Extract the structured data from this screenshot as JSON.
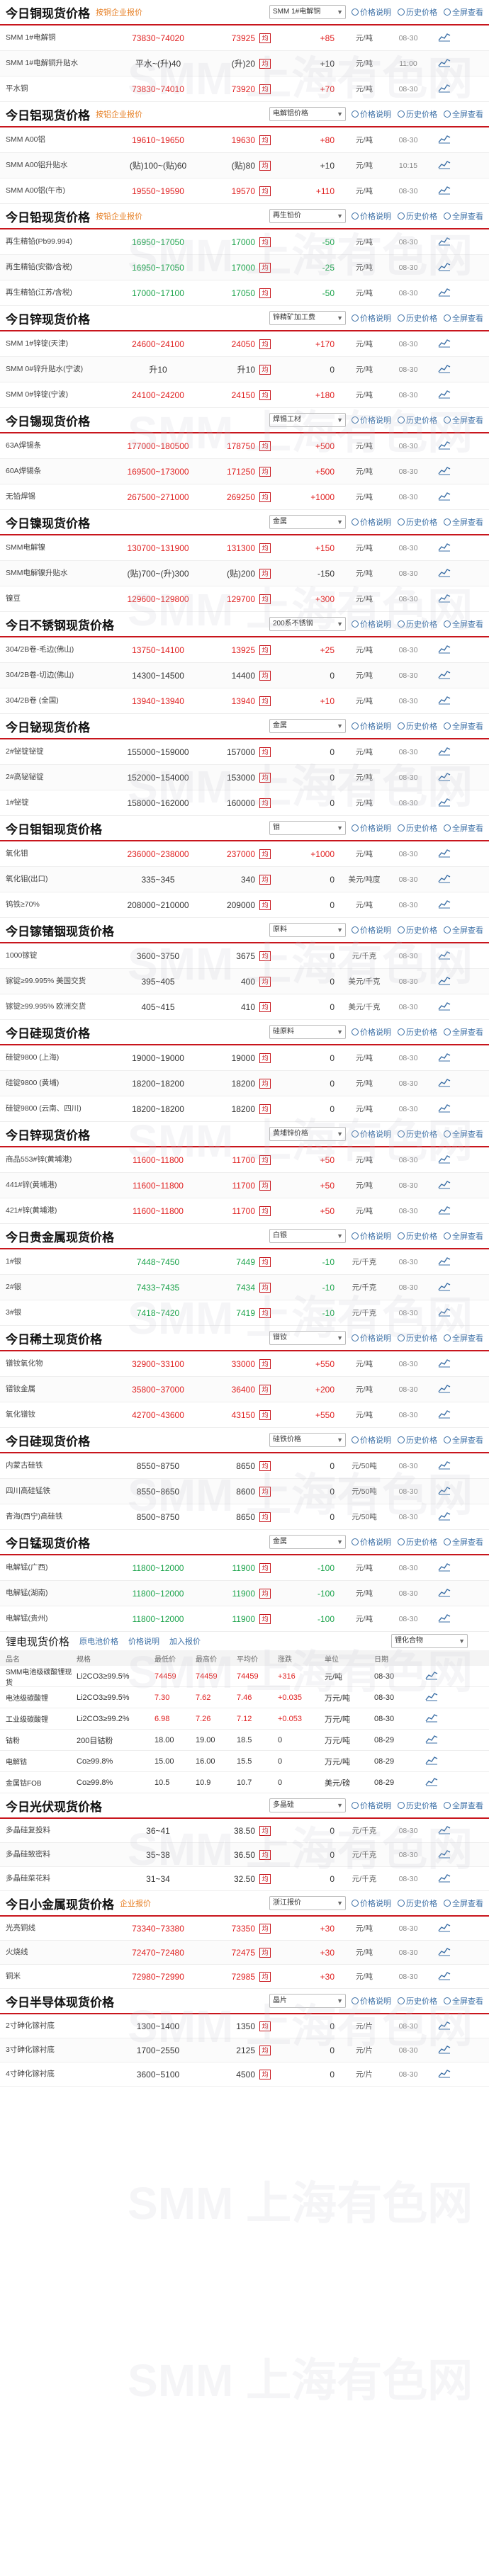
{
  "colors": {
    "accent": "#c8161d",
    "up": "#e02020",
    "down": "#1aa34a",
    "link": "#3a6ea5",
    "sub": "#e67e22"
  },
  "tools": {
    "explain": "价格说明",
    "history": "历史价格",
    "all": "全屏查看"
  },
  "sections": [
    {
      "title": "今日铜现货价格",
      "sub": "按铜企业报价",
      "select": "SMM 1#电解铜",
      "rows": [
        {
          "name": "SMM 1#电解铜",
          "range": "73830~74020",
          "avg": "73925",
          "chg": "+85",
          "dir": "up",
          "unit": "元/吨",
          "date": "08-30"
        },
        {
          "name": "SMM 1#电解铜升贴水",
          "range": "平水~(升)40",
          "avg": "(升)20",
          "chg": "+10",
          "dir": "flat",
          "unit": "元/吨",
          "date": "11:00"
        },
        {
          "name": "平水铜",
          "range": "73830~74010",
          "avg": "73920",
          "chg": "+70",
          "dir": "up",
          "unit": "元/吨",
          "date": "08-30"
        }
      ]
    },
    {
      "title": "今日铝现货价格",
      "sub": "按铝企业报价",
      "select": "电解铝价格",
      "rows": [
        {
          "name": "SMM A00铝",
          "range": "19610~19650",
          "avg": "19630",
          "chg": "+80",
          "dir": "up",
          "unit": "元/吨",
          "date": "08-30"
        },
        {
          "name": "SMM A00铝升贴水",
          "range": "(贴)100~(贴)60",
          "avg": "(贴)80",
          "chg": "+10",
          "dir": "flat",
          "unit": "元/吨",
          "date": "10:15"
        },
        {
          "name": "SMM A00铝(午市)",
          "range": "19550~19590",
          "avg": "19570",
          "chg": "+110",
          "dir": "up",
          "unit": "元/吨",
          "date": "08-30"
        }
      ]
    },
    {
      "title": "今日铅现货价格",
      "sub": "按铅企业报价",
      "select": "再生铅价",
      "rows": [
        {
          "name": "再生精铅(Pb99.994)",
          "range": "16950~17050",
          "avg": "17000",
          "chg": "-50",
          "dir": "dn",
          "unit": "元/吨",
          "date": "08-30"
        },
        {
          "name": "再生精铅(安徽/含税)",
          "range": "16950~17050",
          "avg": "17000",
          "chg": "-25",
          "dir": "dn",
          "unit": "元/吨",
          "date": "08-30"
        },
        {
          "name": "再生精铅(江苏/含税)",
          "range": "17000~17100",
          "avg": "17050",
          "chg": "-50",
          "dir": "dn",
          "unit": "元/吨",
          "date": "08-30"
        }
      ]
    },
    {
      "title": "今日锌现货价格",
      "sub": "",
      "select": "锌精矿加工费",
      "rows": [
        {
          "name": "SMM 1#锌锭(天津)",
          "range": "24600~24100",
          "avg": "24050",
          "chg": "+170",
          "dir": "up",
          "unit": "元/吨",
          "date": "08-30"
        },
        {
          "name": "SMM 0#锌升贴水(宁波)",
          "range": "升10",
          "avg": "升10",
          "chg": "0",
          "dir": "flat",
          "unit": "元/吨",
          "date": "08-30"
        },
        {
          "name": "SMM 0#锌锭(宁波)",
          "range": "24100~24200",
          "avg": "24150",
          "chg": "+180",
          "dir": "up",
          "unit": "元/吨",
          "date": "08-30"
        }
      ]
    },
    {
      "title": "今日锡现货价格",
      "sub": "",
      "select": "焊锡工材",
      "rows": [
        {
          "name": "63A焊锡条",
          "range": "177000~180500",
          "avg": "178750",
          "chg": "+500",
          "dir": "up",
          "unit": "元/吨",
          "date": "08-30"
        },
        {
          "name": "60A焊锡条",
          "range": "169500~173000",
          "avg": "171250",
          "chg": "+500",
          "dir": "up",
          "unit": "元/吨",
          "date": "08-30"
        },
        {
          "name": "无铅焊锡",
          "range": "267500~271000",
          "avg": "269250",
          "chg": "+1000",
          "dir": "up",
          "unit": "元/吨",
          "date": "08-30"
        }
      ]
    },
    {
      "title": "今日镍现货价格",
      "sub": "",
      "select": "金属",
      "rows": [
        {
          "name": "SMM电解镍",
          "range": "130700~131900",
          "avg": "131300",
          "chg": "+150",
          "dir": "up",
          "unit": "元/吨",
          "date": "08-30"
        },
        {
          "name": "SMM电解镍升贴水",
          "range": "(贴)700~(升)300",
          "avg": "(贴)200",
          "chg": "-150",
          "dir": "flat",
          "unit": "元/吨",
          "date": "08-30"
        },
        {
          "name": "镍豆",
          "range": "129600~129800",
          "avg": "129700",
          "chg": "+300",
          "dir": "up",
          "unit": "元/吨",
          "date": "08-30"
        }
      ]
    },
    {
      "title": "今日不锈钢现货价格",
      "sub": "",
      "select": "200系不锈钢",
      "rows": [
        {
          "name": "304/2B卷-毛边(佛山)",
          "range": "13750~14100",
          "avg": "13925",
          "chg": "+25",
          "dir": "up",
          "unit": "元/吨",
          "date": "08-30"
        },
        {
          "name": "304/2B卷-切边(佛山)",
          "range": "14300~14500",
          "avg": "14400",
          "chg": "0",
          "dir": "flat",
          "unit": "元/吨",
          "date": "08-30"
        },
        {
          "name": "304/2B卷 (全国)",
          "range": "13940~13940",
          "avg": "13940",
          "chg": "+10",
          "dir": "up",
          "unit": "元/吨",
          "date": "08-30"
        }
      ]
    },
    {
      "title": "今日铋现货价格",
      "sub": "",
      "select": "金属",
      "rows": [
        {
          "name": "2#铋锭铋锭",
          "range": "155000~159000",
          "avg": "157000",
          "chg": "0",
          "dir": "flat",
          "unit": "元/吨",
          "date": "08-30"
        },
        {
          "name": "2#高铋铋锭",
          "range": "152000~154000",
          "avg": "153000",
          "chg": "0",
          "dir": "flat",
          "unit": "元/吨",
          "date": "08-30"
        },
        {
          "name": "1#铋锭",
          "range": "158000~162000",
          "avg": "160000",
          "chg": "0",
          "dir": "flat",
          "unit": "元/吨",
          "date": "08-30"
        }
      ]
    },
    {
      "title": "今日钼钼现货价格",
      "sub": "",
      "select": "钼",
      "rows": [
        {
          "name": "氧化钼",
          "range": "236000~238000",
          "avg": "237000",
          "chg": "+1000",
          "dir": "up",
          "unit": "元/吨",
          "date": "08-30"
        },
        {
          "name": "氧化钼(出口)",
          "range": "335~345",
          "avg": "340",
          "chg": "0",
          "dir": "flat",
          "unit": "美元/吨度",
          "date": "08-30"
        },
        {
          "name": "钨铁≥70%",
          "range": "208000~210000",
          "avg": "209000",
          "chg": "0",
          "dir": "flat",
          "unit": "元/吨",
          "date": "08-30"
        }
      ]
    },
    {
      "title": "今日镓锗铟现货价格",
      "sub": "",
      "select": "原料",
      "rows": [
        {
          "name": "1000镓锭",
          "range": "3600~3750",
          "avg": "3675",
          "chg": "0",
          "dir": "flat",
          "unit": "元/千克",
          "date": "08-30"
        },
        {
          "name": "镓锭≥99.995% 美国交货",
          "range": "395~405",
          "avg": "400",
          "chg": "0",
          "dir": "flat",
          "unit": "美元/千克",
          "date": "08-30"
        },
        {
          "name": "镓锭≥99.995% 欧洲交货",
          "range": "405~415",
          "avg": "410",
          "chg": "0",
          "dir": "flat",
          "unit": "美元/千克",
          "date": "08-30"
        }
      ]
    },
    {
      "title": "今日硅现货价格",
      "sub": "",
      "select": "硅原料",
      "rows": [
        {
          "name": "硅锭9800 (上海)",
          "range": "19000~19000",
          "avg": "19000",
          "chg": "0",
          "dir": "flat",
          "unit": "元/吨",
          "date": "08-30"
        },
        {
          "name": "硅锭9800 (黄埔)",
          "range": "18200~18200",
          "avg": "18200",
          "chg": "0",
          "dir": "flat",
          "unit": "元/吨",
          "date": "08-30"
        },
        {
          "name": "硅锭9800 (云南、四川)",
          "range": "18200~18200",
          "avg": "18200",
          "chg": "0",
          "dir": "flat",
          "unit": "元/吨",
          "date": "08-30"
        }
      ]
    },
    {
      "title": "今日锌现货价格",
      "sub": "",
      "select": "黄埔锌价格",
      "rows": [
        {
          "name": "商品553#锌(黄埔港)",
          "range": "11600~11800",
          "avg": "11700",
          "chg": "+50",
          "dir": "up",
          "unit": "元/吨",
          "date": "08-30"
        },
        {
          "name": "441#锌(黄埔港)",
          "range": "11600~11800",
          "avg": "11700",
          "chg": "+50",
          "dir": "up",
          "unit": "元/吨",
          "date": "08-30"
        },
        {
          "name": "421#锌(黄埔港)",
          "range": "11600~11800",
          "avg": "11700",
          "chg": "+50",
          "dir": "up",
          "unit": "元/吨",
          "date": "08-30"
        }
      ]
    },
    {
      "title": "今日贵金属现货价格",
      "sub": "",
      "select": "白银",
      "rows": [
        {
          "name": "1#银",
          "range": "7448~7450",
          "avg": "7449",
          "chg": "-10",
          "dir": "dn",
          "unit": "元/千克",
          "date": "08-30"
        },
        {
          "name": "2#银",
          "range": "7433~7435",
          "avg": "7434",
          "chg": "-10",
          "dir": "dn",
          "unit": "元/千克",
          "date": "08-30"
        },
        {
          "name": "3#银",
          "range": "7418~7420",
          "avg": "7419",
          "chg": "-10",
          "dir": "dn",
          "unit": "元/千克",
          "date": "08-30"
        }
      ]
    },
    {
      "title": "今日稀土现货价格",
      "sub": "",
      "select": "镨钕",
      "rows": [
        {
          "name": "镨钕氧化物",
          "range": "32900~33100",
          "avg": "33000",
          "chg": "+550",
          "dir": "up",
          "unit": "元/吨",
          "date": "08-30"
        },
        {
          "name": "镨钕金属",
          "range": "35800~37000",
          "avg": "36400",
          "chg": "+200",
          "dir": "up",
          "unit": "元/吨",
          "date": "08-30"
        },
        {
          "name": "氧化镨钕",
          "range": "42700~43600",
          "avg": "43150",
          "chg": "+550",
          "dir": "up",
          "unit": "元/吨",
          "date": "08-30"
        }
      ]
    },
    {
      "title": "今日硅现货价格",
      "sub": "",
      "select": "硅铁价格",
      "rows": [
        {
          "name": "内蒙古硅铁",
          "range": "8550~8750",
          "avg": "8650",
          "chg": "0",
          "dir": "flat",
          "unit": "元/50吨",
          "date": "08-30"
        },
        {
          "name": "四川高硅锰铁",
          "range": "8550~8650",
          "avg": "8600",
          "chg": "0",
          "dir": "flat",
          "unit": "元/50吨",
          "date": "08-30"
        },
        {
          "name": "青海(西宁)高硅铁",
          "range": "8500~8750",
          "avg": "8650",
          "chg": "0",
          "dir": "flat",
          "unit": "元/50吨",
          "date": "08-30"
        }
      ]
    },
    {
      "title": "今日锰现货价格",
      "sub": "",
      "select": "金属",
      "rows": [
        {
          "name": "电解锰(广西)",
          "range": "11800~12000",
          "avg": "11900",
          "chg": "-100",
          "dir": "dn",
          "unit": "元/吨",
          "date": "08-30"
        },
        {
          "name": "电解锰(湖南)",
          "range": "11800~12000",
          "avg": "11900",
          "chg": "-100",
          "dir": "dn",
          "unit": "元/吨",
          "date": "08-30"
        },
        {
          "name": "电解锰(贵州)",
          "range": "11800~12000",
          "avg": "11900",
          "chg": "-100",
          "dir": "dn",
          "unit": "元/吨",
          "date": "08-30"
        }
      ]
    }
  ],
  "lithium": {
    "title": "锂电现货价格",
    "tabs": [
      "原电池价格",
      "价格说明",
      "加入报价"
    ],
    "select": "锂化合物",
    "headers": [
      "品名",
      "规格",
      "最低价",
      "最高价",
      "平均价",
      "涨跌",
      "单位",
      "日期"
    ],
    "rows": [
      {
        "name": "SMM电池级碳酸锂现货",
        "spec": "Li2CO3≥99.5%",
        "lo": "74459",
        "hi": "74459",
        "avg": "74459",
        "chg": "+316",
        "dir": "up",
        "unit": "元/吨",
        "date": "08-30"
      },
      {
        "name": "电池级碳酸锂",
        "spec": "Li2CO3≥99.5%",
        "lo": "7.30",
        "hi": "7.62",
        "avg": "7.46",
        "chg": "+0.035",
        "dir": "up",
        "unit": "万元/吨",
        "date": "08-30"
      },
      {
        "name": "工业级碳酸锂",
        "spec": "Li2CO3≥99.2%",
        "lo": "6.98",
        "hi": "7.26",
        "avg": "7.12",
        "chg": "+0.053",
        "dir": "up",
        "unit": "万元/吨",
        "date": "08-30"
      },
      {
        "name": "钴粉",
        "spec": "200目钴粉",
        "lo": "18.00",
        "hi": "19.00",
        "avg": "18.5",
        "chg": "0",
        "dir": "flat",
        "unit": "万元/吨",
        "date": "08-29"
      },
      {
        "name": "电解钴",
        "spec": "Co≥99.8%",
        "lo": "15.00",
        "hi": "16.00",
        "avg": "15.5",
        "chg": "0",
        "dir": "flat",
        "unit": "万元/吨",
        "date": "08-29"
      },
      {
        "name": "金属钴FOB",
        "spec": "Co≥99.8%",
        "lo": "10.5",
        "hi": "10.9",
        "avg": "10.7",
        "chg": "0",
        "dir": "flat",
        "unit": "美元/磅",
        "date": "08-29"
      }
    ]
  },
  "sections2": [
    {
      "title": "今日光伏现货价格",
      "sub": "",
      "select": "多晶硅",
      "rows": [
        {
          "name": "多晶硅复投料",
          "range": "36~41",
          "avg": "38.50",
          "chg": "0",
          "dir": "flat",
          "unit": "元/千克",
          "date": "08-30"
        },
        {
          "name": "多晶硅致密料",
          "range": "35~38",
          "avg": "36.50",
          "chg": "0",
          "dir": "flat",
          "unit": "元/千克",
          "date": "08-30"
        },
        {
          "name": "多晶硅菜花料",
          "range": "31~34",
          "avg": "32.50",
          "chg": "0",
          "dir": "flat",
          "unit": "元/千克",
          "date": "08-30"
        }
      ]
    },
    {
      "title": "今日小金属现货价格",
      "sub": "企业报价",
      "select": "浙江报价",
      "rows": [
        {
          "name": "光亮铜线",
          "range": "73340~73380",
          "avg": "73350",
          "chg": "+30",
          "dir": "up",
          "unit": "元/吨",
          "date": "08-30"
        },
        {
          "name": "火烧线",
          "range": "72470~72480",
          "avg": "72475",
          "chg": "+30",
          "dir": "up",
          "unit": "元/吨",
          "date": "08-30"
        },
        {
          "name": "铜米",
          "range": "72980~72990",
          "avg": "72985",
          "chg": "+30",
          "dir": "up",
          "unit": "元/吨",
          "date": "08-30"
        }
      ]
    },
    {
      "title": "今日半导体现货价格",
      "sub": "",
      "select": "晶片",
      "rows": [
        {
          "name": "2寸砷化镓衬底",
          "range": "1300~1400",
          "avg": "1350",
          "chg": "0",
          "dir": "flat",
          "unit": "元/片",
          "date": "08-30"
        },
        {
          "name": "3寸砷化镓衬底",
          "range": "1700~2550",
          "avg": "2125",
          "chg": "0",
          "dir": "flat",
          "unit": "元/片",
          "date": "08-30"
        },
        {
          "name": "4寸砷化镓衬底",
          "range": "3600~5100",
          "avg": "4500",
          "chg": "0",
          "dir": "flat",
          "unit": "元/片",
          "date": "08-30"
        }
      ]
    }
  ]
}
